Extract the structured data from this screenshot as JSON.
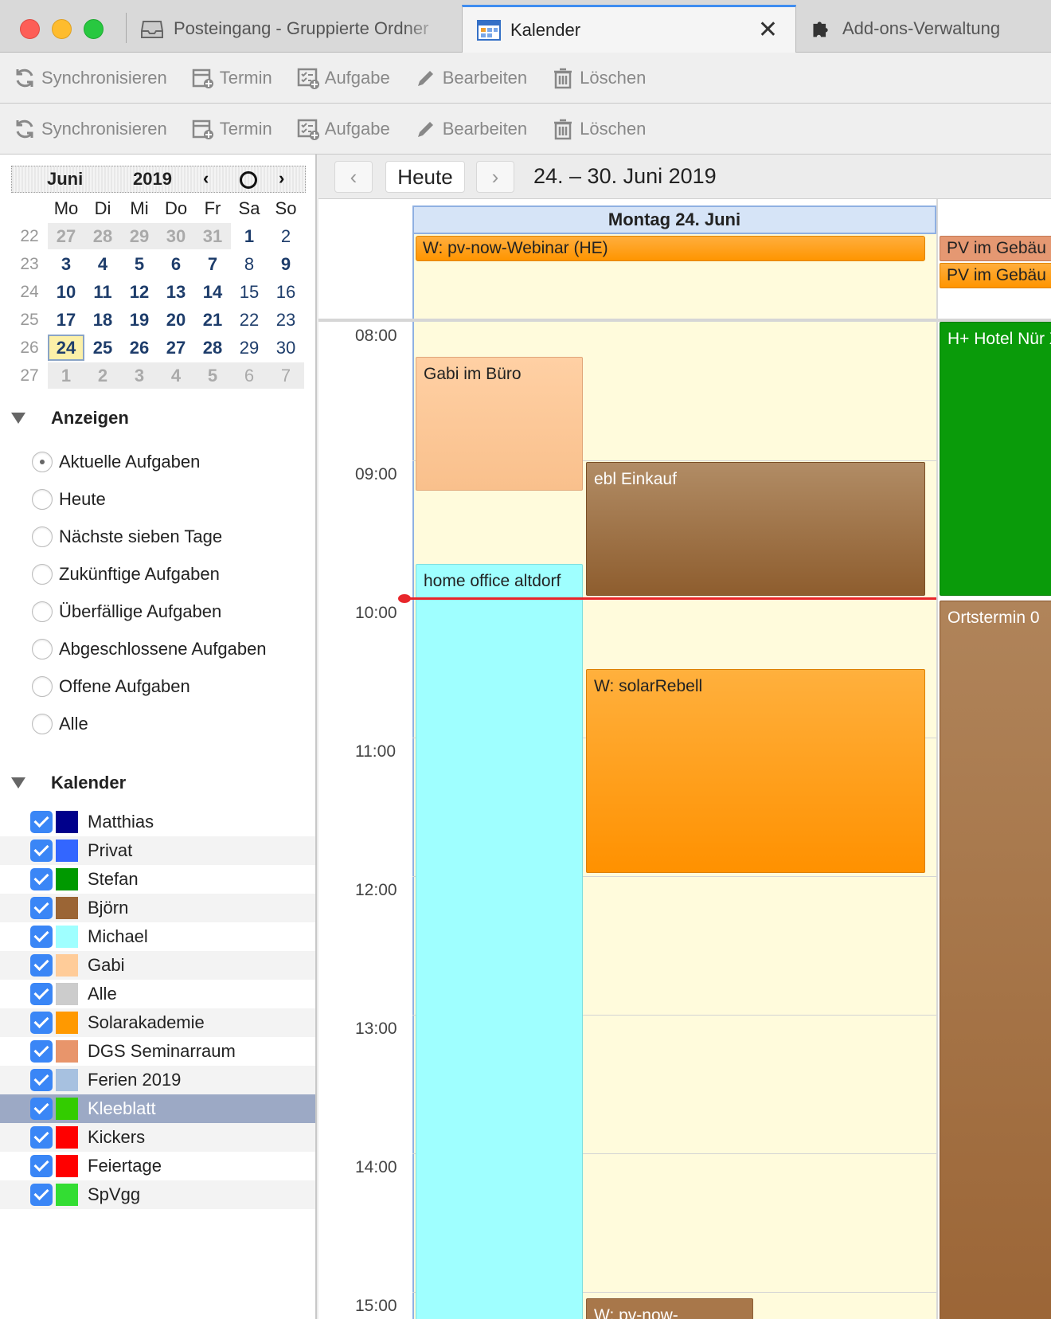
{
  "tabs": [
    {
      "label": "Posteingang - Gruppierte Ordner",
      "icon": "inbox-icon"
    },
    {
      "label": "Kalender",
      "icon": "calendar-icon",
      "active": true
    },
    {
      "label": "Add-ons-Verwaltung",
      "icon": "puzzle-icon"
    }
  ],
  "toolbar": {
    "sync": "Synchronisieren",
    "event": "Termin",
    "task": "Aufgabe",
    "edit": "Bearbeiten",
    "delete": "Löschen"
  },
  "minimonth": {
    "month": "Juni",
    "year": "2019",
    "weekdays": [
      "Mo",
      "Di",
      "Mi",
      "Do",
      "Fr",
      "Sa",
      "So"
    ],
    "weeks": [
      {
        "wk": "22",
        "days": [
          "27",
          "28",
          "29",
          "30",
          "31",
          "1",
          "2"
        ]
      },
      {
        "wk": "23",
        "days": [
          "3",
          "4",
          "5",
          "6",
          "7",
          "8",
          "9"
        ]
      },
      {
        "wk": "24",
        "days": [
          "10",
          "11",
          "12",
          "13",
          "14",
          "15",
          "16"
        ]
      },
      {
        "wk": "25",
        "days": [
          "17",
          "18",
          "19",
          "20",
          "21",
          "22",
          "23"
        ]
      },
      {
        "wk": "26",
        "days": [
          "24",
          "25",
          "26",
          "27",
          "28",
          "29",
          "30"
        ]
      },
      {
        "wk": "27",
        "days": [
          "1",
          "2",
          "3",
          "4",
          "5",
          "6",
          "7"
        ]
      }
    ]
  },
  "show_section": {
    "title": "Anzeigen",
    "options": [
      "Aktuelle Aufgaben",
      "Heute",
      "Nächste sieben Tage",
      "Zukünftige Aufgaben",
      "Überfällige Aufgaben",
      "Abgeschlossene Aufgaben",
      "Offene Aufgaben",
      "Alle"
    ],
    "selected": "Aktuelle Aufgaben"
  },
  "calendar_section": {
    "title": "Kalender",
    "calendars": [
      {
        "name": "Matthias",
        "color": "#00008b"
      },
      {
        "name": "Privat",
        "color": "#3366ff"
      },
      {
        "name": "Stefan",
        "color": "#009900"
      },
      {
        "name": "Björn",
        "color": "#9b6535"
      },
      {
        "name": "Michael",
        "color": "#9fffff"
      },
      {
        "name": "Gabi",
        "color": "#ffcc99"
      },
      {
        "name": "Alle",
        "color": "#cccccc"
      },
      {
        "name": "Solarakademie",
        "color": "#ff9900"
      },
      {
        "name": "DGS Seminarraum",
        "color": "#e8956b"
      },
      {
        "name": "Ferien 2019",
        "color": "#a7c1e0"
      },
      {
        "name": "Kleeblatt",
        "color": "#33cc00"
      },
      {
        "name": "Kickers",
        "color": "#ff0000"
      },
      {
        "name": "Feiertage",
        "color": "#ff0000"
      },
      {
        "name": "SpVgg",
        "color": "#33dd33"
      }
    ],
    "selected": "Kleeblatt"
  },
  "nav": {
    "today": "Heute",
    "range": "24. – 30. Juni 2019"
  },
  "day_view": {
    "day_header": "Montag 24. Juni",
    "hours": [
      "08:00",
      "09:00",
      "10:00",
      "11:00",
      "12:00",
      "13:00",
      "14:00",
      "15:00"
    ],
    "events": {
      "webinar": "W: pv-now-Webinar (HE)",
      "pv1": "PV im Gebäu",
      "pv2": "PV im Gebäu",
      "gabi": "Gabi im Büro",
      "ebl": "ebl Einkauf",
      "home": "home office altdorf",
      "solar": "W: solarRebell",
      "wpv": "W: pv-now-",
      "hotel": "H+ Hotel Nür XXL-Stornog",
      "orts": "Ortstermin 0"
    }
  }
}
